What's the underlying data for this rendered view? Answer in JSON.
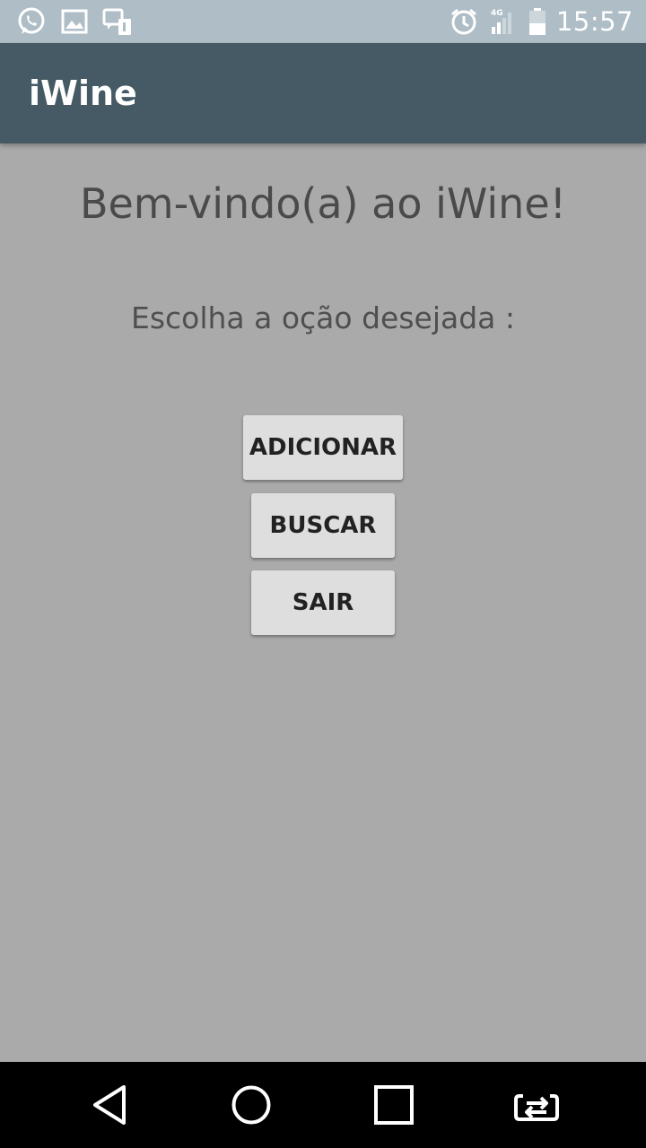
{
  "status_bar": {
    "time": "15:57",
    "network": "4G",
    "icons_left": [
      "whatsapp-icon",
      "gallery-icon",
      "sim-message-icon"
    ],
    "icons_right": [
      "alarm-icon",
      "signal-icon",
      "battery-icon"
    ]
  },
  "app_bar": {
    "title": "iWine"
  },
  "main": {
    "welcome": "Bem-vindo(a) ao iWine!",
    "prompt": "Escolha a oção desejada :",
    "buttons": {
      "add": "ADICIONAR",
      "search": "BUSCAR",
      "exit": "SAIR"
    }
  },
  "nav_bar": {
    "icons": [
      "back-icon",
      "home-icon",
      "recent-apps-icon",
      "app-switch-icon"
    ]
  },
  "colors": {
    "status_bar": "#aebdc6",
    "app_bar": "#455a64",
    "background": "#aaaaaa",
    "button": "#dedede"
  }
}
